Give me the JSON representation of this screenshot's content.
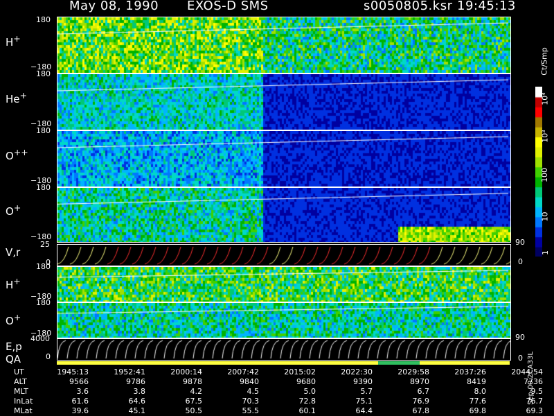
{
  "header": {
    "date": "May 08, 1990",
    "instrument": "EXOS-D SMS",
    "file": "s0050805.ksr",
    "time": "19:45:13"
  },
  "panels": [
    {
      "id": "h1",
      "label": "H",
      "sup": "+",
      "ytop": "180",
      "ybot": "−180"
    },
    {
      "id": "he",
      "label": "He",
      "sup": "+",
      "ytop": "180",
      "ybot": "−180"
    },
    {
      "id": "o2",
      "label": "O",
      "sup": "++",
      "ytop": "180",
      "ybot": "−180"
    },
    {
      "id": "o1",
      "label": "O",
      "sup": "+",
      "ytop": "180",
      "ybot": "−180"
    },
    {
      "id": "vr",
      "label": "V,r",
      "sup": "",
      "ytop": "25",
      "ybot": "0"
    },
    {
      "id": "h2",
      "label": "H",
      "sup": "+",
      "ytop": "180",
      "ybot": "−180"
    },
    {
      "id": "o3",
      "label": "O",
      "sup": "+",
      "ytop": "180",
      "ybot": "−180"
    },
    {
      "id": "ep",
      "label": "E,p",
      "sup": "",
      "ytop": "4000",
      "ybot": "0"
    }
  ],
  "qa_label": "QA",
  "right_scales": {
    "vr_top": "90",
    "vr_bot": "0",
    "ep_top": "90",
    "ep_bot": "0"
  },
  "colorbar": {
    "unit": "Ct/Smp",
    "labels": [
      "1",
      "10",
      "100",
      "10³",
      "10⁴"
    ],
    "colors": [
      "#000060",
      "#0000a0",
      "#0030e0",
      "#0078ff",
      "#00b4ff",
      "#00d8c8",
      "#00c878",
      "#00b400",
      "#40d000",
      "#a0e000",
      "#e0f000",
      "#ffff00",
      "#c8b400",
      "#a07800",
      "#ff0000",
      "#c00000",
      "#ffffff"
    ]
  },
  "footer": {
    "rows": [
      {
        "name": "UT",
        "values": [
          "1945:13",
          "1952:41",
          "2000:14",
          "2007:42",
          "2015:02",
          "2022:30",
          "2029:58",
          "2037:26",
          "2044:54"
        ]
      },
      {
        "name": "ALT",
        "values": [
          "9566",
          "9786",
          "9878",
          "9840",
          "9680",
          "9390",
          "8970",
          "8419",
          "7736"
        ]
      },
      {
        "name": "MLT",
        "values": [
          "3.6",
          "3.8",
          "4.2",
          "4.5",
          "5.0",
          "5.7",
          "6.7",
          "8.0",
          "9.5"
        ]
      },
      {
        "name": "InLat",
        "values": [
          "61.6",
          "64.6",
          "67.5",
          "70.3",
          "72.8",
          "75.1",
          "76.9",
          "77.6",
          "76.7"
        ]
      },
      {
        "name": "MLat",
        "values": [
          "39.6",
          "45.1",
          "50.5",
          "55.5",
          "60.1",
          "64.4",
          "67.8",
          "69.8",
          "69.3"
        ]
      }
    ],
    "side_label": "Sep-00  2CA33L"
  }
}
